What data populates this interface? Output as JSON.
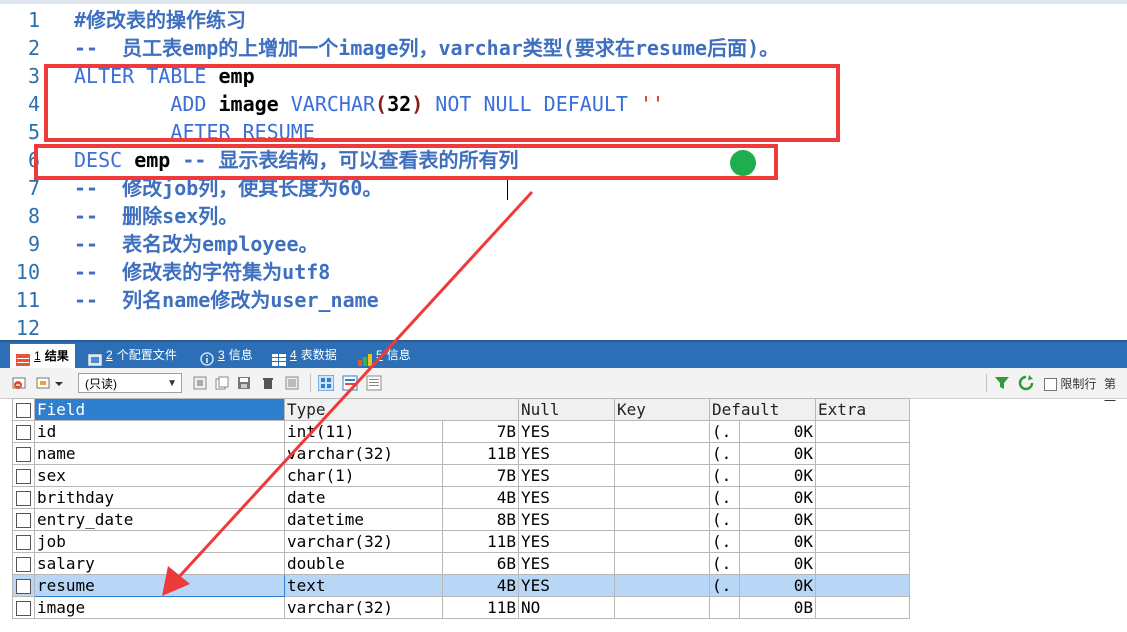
{
  "editor": {
    "lines": [
      {
        "n": "1",
        "parts": [
          {
            "c": "cm",
            "t": "#修改表的操作练习"
          }
        ]
      },
      {
        "n": "2",
        "parts": [
          {
            "c": "cm",
            "t": "--  员工表emp的上增加一个image列，varchar类型(要求在resume后面)。"
          }
        ]
      },
      {
        "n": "3",
        "parts": [
          {
            "c": "kw",
            "t": "ALTER TABLE "
          },
          {
            "c": "plain",
            "t": "emp"
          }
        ]
      },
      {
        "n": "4",
        "parts": [
          {
            "c": "plain",
            "t": "        "
          },
          {
            "c": "kw",
            "t": "ADD "
          },
          {
            "c": "plain",
            "t": "image "
          },
          {
            "c": "kw",
            "t": "VARCHAR"
          },
          {
            "c": "paren",
            "t": "("
          },
          {
            "c": "num",
            "t": "32"
          },
          {
            "c": "paren",
            "t": ")"
          },
          {
            "c": "plain",
            "t": " "
          },
          {
            "c": "kw",
            "t": "NOT NULL DEFAULT "
          },
          {
            "c": "str",
            "t": "''"
          }
        ]
      },
      {
        "n": "5",
        "parts": [
          {
            "c": "plain",
            "t": "        "
          },
          {
            "c": "kw",
            "t": "AFTER RESUME"
          }
        ]
      },
      {
        "n": "6",
        "parts": [
          {
            "c": "kw",
            "t": "DESC "
          },
          {
            "c": "plain",
            "t": "emp "
          },
          {
            "c": "cm",
            "t": "-- 显示表结构，可以查看表的所有列"
          }
        ]
      },
      {
        "n": "7",
        "parts": [
          {
            "c": "cm",
            "t": "--  修改job列，使其长度为60。"
          }
        ]
      },
      {
        "n": "8",
        "parts": [
          {
            "c": "cm",
            "t": "--  删除sex列。"
          }
        ]
      },
      {
        "n": "9",
        "parts": [
          {
            "c": "cm",
            "t": "--  表名改为employee。"
          }
        ]
      },
      {
        "n": "10",
        "parts": [
          {
            "c": "cm",
            "t": "--  修改表的字符集为utf8"
          }
        ]
      },
      {
        "n": "11",
        "parts": [
          {
            "c": "cm",
            "t": "--  列名name修改为user_name"
          }
        ]
      },
      {
        "n": "12",
        "parts": []
      }
    ]
  },
  "tabs": [
    {
      "num": "1",
      "label": "结果",
      "active": true
    },
    {
      "num": "2",
      "label": "个配置文件",
      "active": false
    },
    {
      "num": "3",
      "label": "信息",
      "active": false
    },
    {
      "num": "4",
      "label": "表数据",
      "active": false
    },
    {
      "num": "5",
      "label": "信息",
      "active": false
    }
  ],
  "toolbar": {
    "mode_select": "(只读)",
    "limit_rows_label": "限制行",
    "page_label": "第一"
  },
  "grid": {
    "headers": [
      "Field",
      "Type",
      "",
      "Null",
      "Key",
      "Default",
      "",
      "Extra"
    ],
    "rows": [
      {
        "field": "id",
        "type": "int(11)",
        "len": "7B",
        "null": "YES",
        "key": "",
        "defp": "(.",
        "def": "0K",
        "extra": ""
      },
      {
        "field": "name",
        "type": "varchar(32)",
        "len": "11B",
        "null": "YES",
        "key": "",
        "defp": "(.",
        "def": "0K",
        "extra": ""
      },
      {
        "field": "sex",
        "type": "char(1)",
        "len": "7B",
        "null": "YES",
        "key": "",
        "defp": "(.",
        "def": "0K",
        "extra": ""
      },
      {
        "field": "brithday",
        "type": "date",
        "len": "4B",
        "null": "YES",
        "key": "",
        "defp": "(.",
        "def": "0K",
        "extra": ""
      },
      {
        "field": "entry_date",
        "type": "datetime",
        "len": "8B",
        "null": "YES",
        "key": "",
        "defp": "(.",
        "def": "0K",
        "extra": ""
      },
      {
        "field": "job",
        "type": "varchar(32)",
        "len": "11B",
        "null": "YES",
        "key": "",
        "defp": "(.",
        "def": "0K",
        "extra": ""
      },
      {
        "field": "salary",
        "type": "double",
        "len": "6B",
        "null": "YES",
        "key": "",
        "defp": "(.",
        "def": "0K",
        "extra": ""
      },
      {
        "field": "resume",
        "type": "text",
        "len": "4B",
        "null": "YES",
        "key": "",
        "defp": "(.",
        "def": "0K",
        "extra": "",
        "selected": true
      },
      {
        "field": "image",
        "type": "varchar(32)",
        "len": "11B",
        "null": "NO",
        "key": "",
        "defp": "",
        "def": "0B",
        "extra": ""
      }
    ]
  },
  "colors": {
    "annotation_red": "#ee3a3a",
    "annotation_green": "#1fae4d",
    "tab_bar": "#2d6fb6",
    "header_selected": "#2f7fd0",
    "row_selected": "#b8d6f6"
  }
}
